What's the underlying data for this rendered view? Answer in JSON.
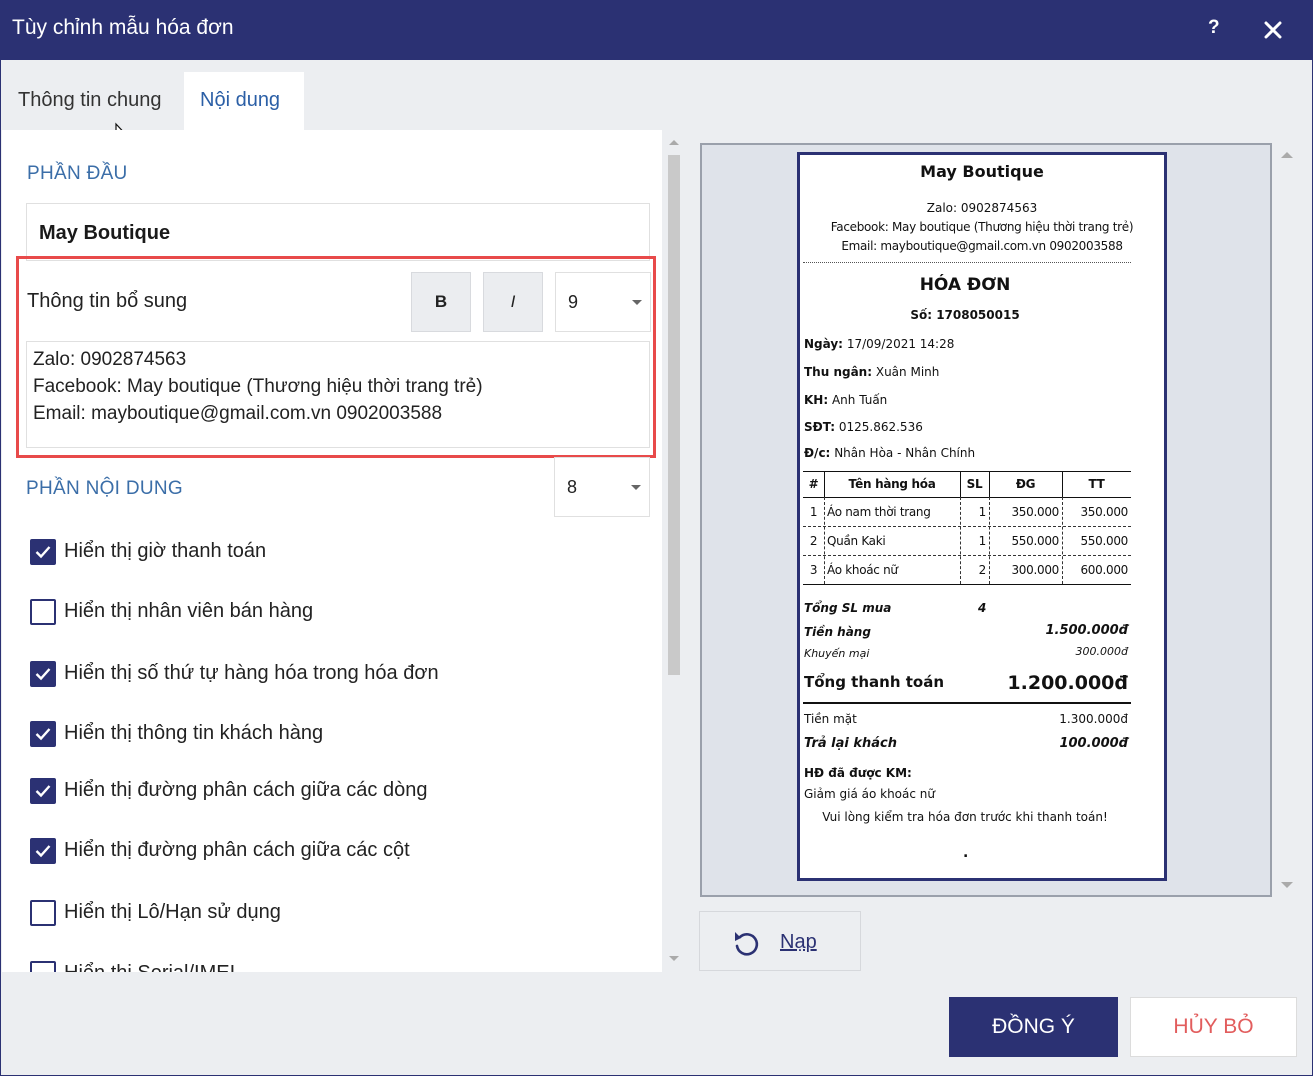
{
  "window": {
    "title": "Tùy chỉnh mẫu hóa đơn",
    "help_label": "?"
  },
  "tabs": [
    {
      "label": "Thông tin chung"
    },
    {
      "label": "Nội dung"
    }
  ],
  "header_section": {
    "title": "PHẦN ĐẦU",
    "shop_name": "May Boutique",
    "extra_label": "Thông tin bổ sung",
    "bold_label": "B",
    "italic_label": "I",
    "font_size": "9",
    "extra_lines": [
      "Zalo: 0902874563",
      "Facebook: May boutique (Thương hiệu thời trang trẻ)",
      "Email: mayboutique@gmail.com.vn 0902003588"
    ]
  },
  "content_section": {
    "title": "PHẦN NỘI DUNG",
    "font_size": "8",
    "options": [
      {
        "label": "Hiển thị giờ thanh toán",
        "checked": true
      },
      {
        "label": "Hiển thị nhân viên bán hàng",
        "checked": false
      },
      {
        "label": "Hiển thị số thứ tự hàng hóa trong hóa đơn",
        "checked": true
      },
      {
        "label": "Hiển thị thông tin khách hàng",
        "checked": true
      },
      {
        "label": "Hiển thị đường phân cách giữa các dòng",
        "checked": true
      },
      {
        "label": "Hiển thị đường phân cách giữa các cột",
        "checked": true
      },
      {
        "label": "Hiển thị Lô/Hạn sử dụng",
        "checked": false
      },
      {
        "label": "Hiển thị Serial/IMEI",
        "checked": false
      }
    ]
  },
  "receipt": {
    "shop_name": "May Boutique",
    "lines": [
      "Zalo: 0902874563",
      "Facebook: May boutique (Thương hiệu thời trang trẻ)",
      "Email: mayboutique@gmail.com.vn 0902003588"
    ],
    "title": "HÓA ĐƠN",
    "number_label": "Số:",
    "number": "1708050015",
    "date_label": "Ngày:",
    "date": "17/09/2021 14:28",
    "cashier_label": "Thu ngân:",
    "cashier": "Xuân Minh",
    "customer_label": "KH:",
    "customer": "Anh Tuấn",
    "phone_label": "SĐT:",
    "phone": "0125.862.536",
    "address_label": "Đ/c:",
    "address": "Nhân Hòa - Nhân Chính",
    "columns": [
      "#",
      "Tên hàng hóa",
      "SL",
      "ĐG",
      "TT"
    ],
    "items": [
      {
        "no": "1",
        "name": "Áo nam thời trang",
        "qty": "1",
        "price": "350.000",
        "total": "350.000"
      },
      {
        "no": "2",
        "name": "Quần Kaki",
        "qty": "1",
        "price": "550.000",
        "total": "550.000"
      },
      {
        "no": "3",
        "name": "Áo khoác nữ",
        "qty": "2",
        "price": "300.000",
        "total": "600.000"
      }
    ],
    "total_qty_label": "Tổng SL mua",
    "total_qty": "4",
    "goods_label": "Tiền hàng",
    "goods": "1.500.000đ",
    "discount_label": "Khuyến mại",
    "discount": "300.000đ",
    "grand_label": "Tổng thanh toán",
    "grand": "1.200.000đ",
    "cash_label": "Tiền mặt",
    "cash": "1.300.000đ",
    "change_label": "Trả lại khách",
    "change": "100.000đ",
    "promo_label": "HĐ đã được KM:",
    "promo": "Giảm giá áo khoác nữ",
    "footer_note": "Vui lòng kiểm tra hóa đơn trước khi thanh toán!",
    "end_mark": "."
  },
  "actions": {
    "reload_label": "Nạp",
    "ok_label": "ĐỒNG Ý",
    "cancel_label": "HỦY BỎ"
  },
  "colors": {
    "primary": "#2b3173",
    "link": "#2b5fa6",
    "highlight_border": "#e84a4a",
    "cancel_text": "#e25d5d"
  }
}
